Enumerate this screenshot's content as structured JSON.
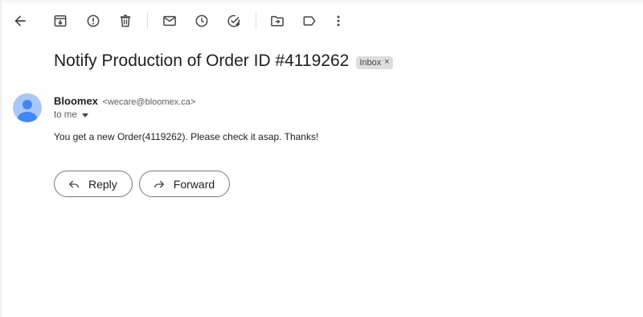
{
  "toolbar": {
    "icons": [
      "back-arrow-icon",
      "archive-icon",
      "report-spam-icon",
      "delete-icon",
      "mark-unread-icon",
      "snooze-icon",
      "add-to-tasks-icon",
      "move-to-icon",
      "labels-icon",
      "more-icon"
    ]
  },
  "email": {
    "subject": "Notify Production of Order ID #4119262",
    "label": "Inbox",
    "label_remove": "×",
    "sender_name": "Bloomex",
    "sender_email": "<wecare@bloomex.ca>",
    "recipient": "to me",
    "body": "You get a new Order(4119262). Please check it asap. Thanks!"
  },
  "actions": {
    "reply_label": "Reply",
    "forward_label": "Forward"
  },
  "colors": {
    "avatar_bg": "#a8c7fa",
    "avatar_fg": "#4285f4",
    "chip_bg": "#dddddd"
  }
}
